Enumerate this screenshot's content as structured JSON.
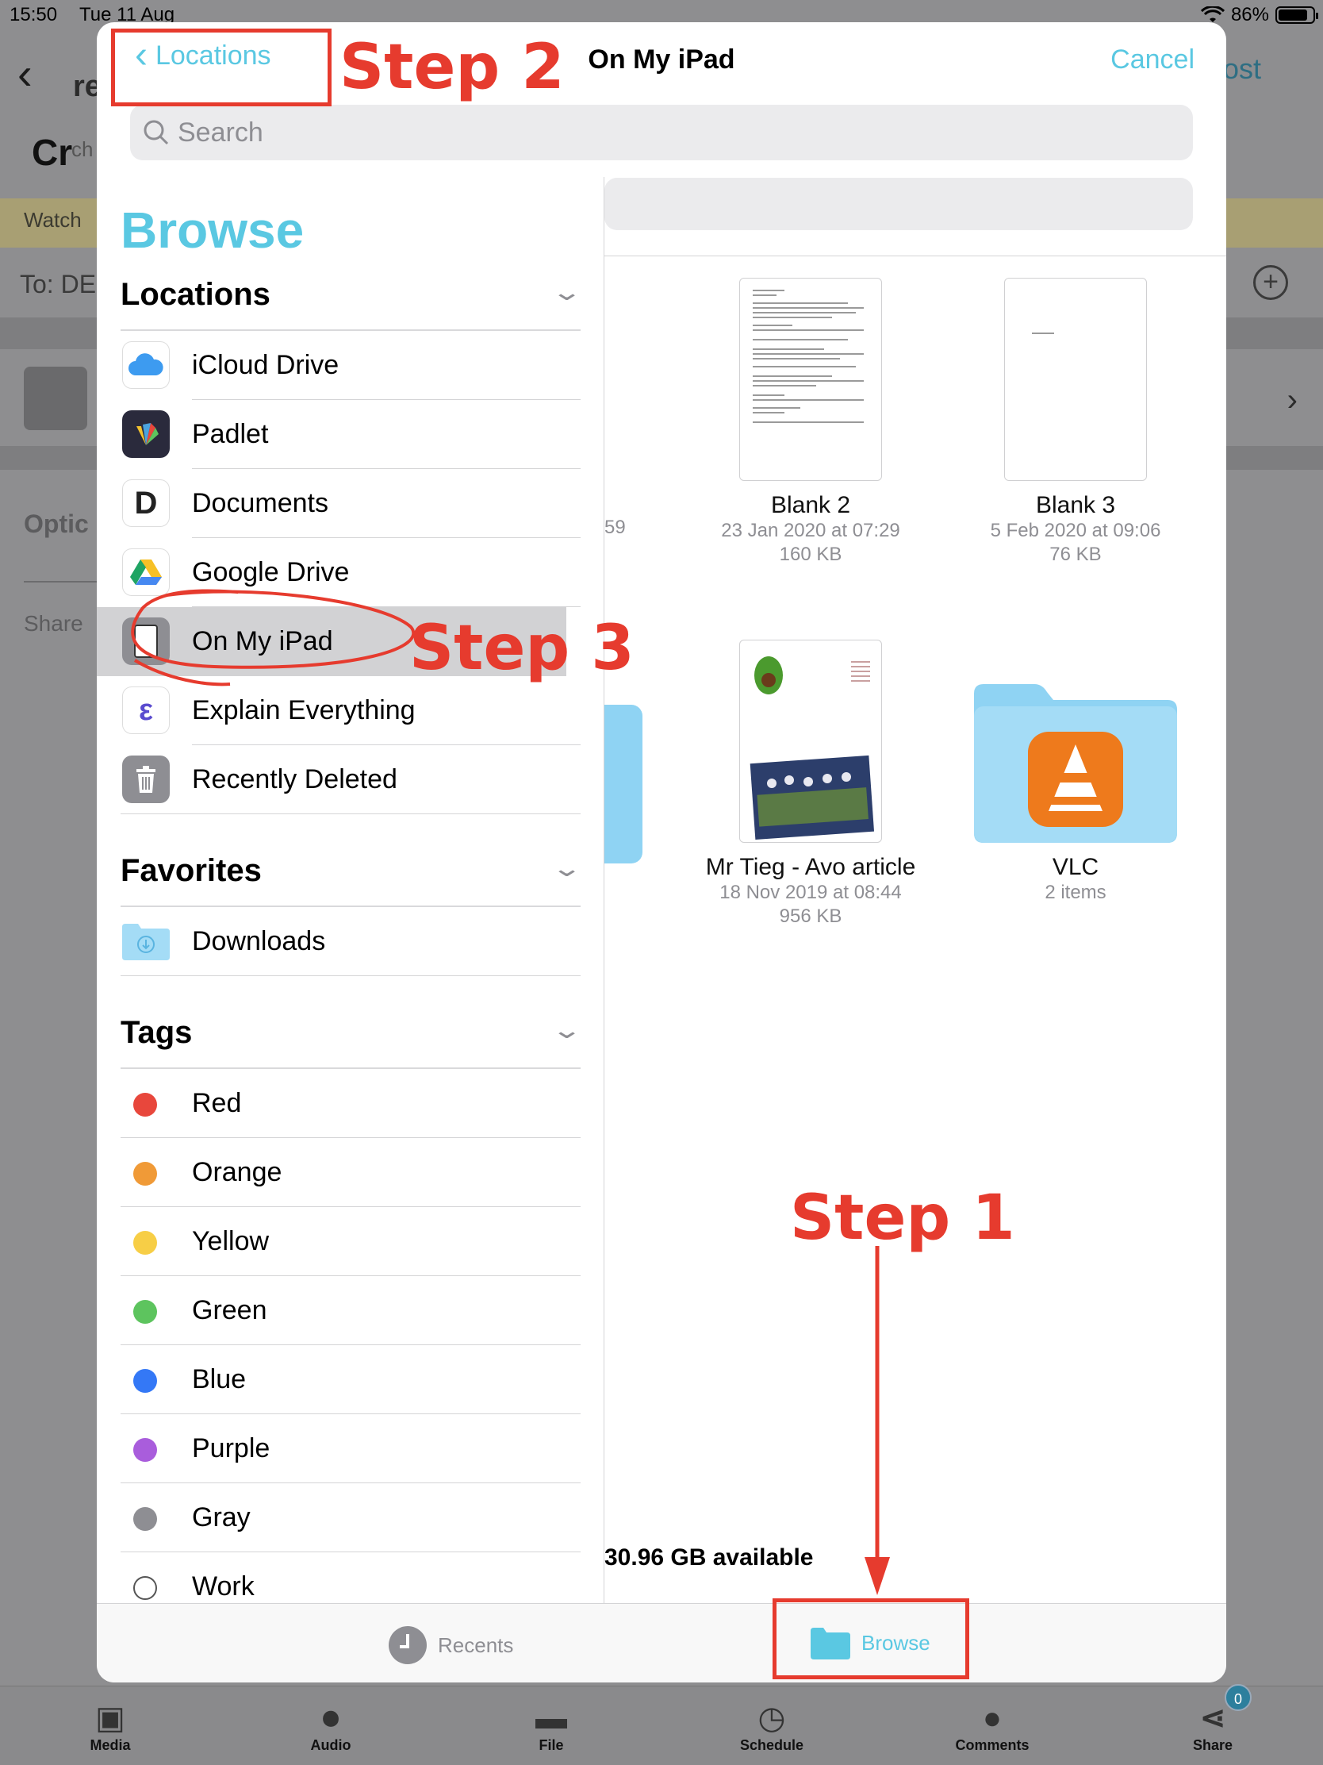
{
  "status_bar": {
    "time": "15:50",
    "date": "Tue 11 Aug",
    "battery": "86%",
    "battery_level": 0.86
  },
  "background_app": {
    "title_fragment": "re",
    "heading_fragment": "Cr",
    "heading_fragment_2": "ch",
    "watch_label": "Watch",
    "to_label": "To:  DE",
    "options_label": "Optic",
    "share_label": "Share",
    "post_fragment": "ost",
    "toolbar": [
      {
        "label": "Media",
        "icon": "camera-icon"
      },
      {
        "label": "Audio",
        "icon": "microphone-icon"
      },
      {
        "label": "File",
        "icon": "folder-icon"
      },
      {
        "label": "Schedule",
        "icon": "clock-icon"
      },
      {
        "label": "Comments",
        "icon": "comment-icon"
      },
      {
        "label": "Share",
        "icon": "share-icon"
      }
    ],
    "share_badge": "0"
  },
  "picker": {
    "back_label": "Locations",
    "title": "On My iPad",
    "cancel_label": "Cancel",
    "search_placeholder": "Search",
    "browse_title": "Browse",
    "sections": {
      "locations": "Locations",
      "favorites": "Favorites",
      "tags": "Tags"
    },
    "locations": [
      "iCloud Drive",
      "Padlet",
      "Documents",
      "Google Drive",
      "On My iPad",
      "Explain Everything",
      "Recently Deleted"
    ],
    "favorites": [
      "Downloads"
    ],
    "tags": [
      {
        "label": "Red",
        "color": "#e8473c"
      },
      {
        "label": "Orange",
        "color": "#f09a37"
      },
      {
        "label": "Yellow",
        "color": "#f7ce46"
      },
      {
        "label": "Green",
        "color": "#5dc45e"
      },
      {
        "label": "Blue",
        "color": "#3478f6"
      },
      {
        "label": "Purple",
        "color": "#a95ddc"
      },
      {
        "label": "Gray",
        "color": "#8e8e93"
      },
      {
        "label": "Work",
        "color": "#ffffff"
      }
    ],
    "files": [
      {
        "name": "Blank 2",
        "date": "23 Jan 2020 at 07:29",
        "size": "160 KB"
      },
      {
        "name": "Blank 3",
        "date": "5 Feb 2020 at 09:06",
        "size": "76 KB"
      },
      {
        "name": "Mr Tieg - Avo article",
        "date": "18 Nov 2019 at 08:44",
        "size": "956 KB"
      },
      {
        "name": "VLC",
        "date": "",
        "size": "2 items"
      }
    ],
    "partial_meta": "59",
    "available": "30.96 GB available",
    "tabs": {
      "recents": "Recents",
      "browse": "Browse"
    }
  },
  "annotations": {
    "step1": "Step 1",
    "step2": "Step 2",
    "step3": "Step 3"
  },
  "accent_color": "#5ac8e2",
  "annotation_color": "#e63b2e"
}
